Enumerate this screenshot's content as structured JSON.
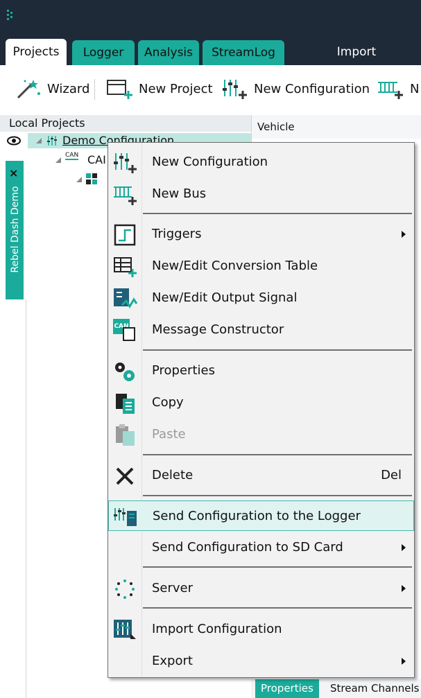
{
  "tabs": [
    {
      "label": "Projects"
    },
    {
      "label": "Logger"
    },
    {
      "label": "Analysis"
    },
    {
      "label": "StreamLog"
    },
    {
      "label": "Import"
    }
  ],
  "ribbon": {
    "wizard": "Wizard",
    "new_project": "New Project",
    "new_configuration": "New Configuration",
    "new_bus_partial": "N"
  },
  "left_panel": {
    "header": "Local Projects",
    "tree": {
      "project": "Demo Configuration",
      "bus": "CAI",
      "bus_icon_text": "CAN"
    },
    "side_tab": "Rebel Dash Demo",
    "side_tab_close": "×"
  },
  "right_panel": {
    "header": "Vehicle",
    "bottom_tabs": [
      {
        "label": "Properties"
      },
      {
        "label": "Stream Channels"
      }
    ]
  },
  "context_menu": {
    "items": [
      {
        "label": "New Configuration",
        "icon": "new-configuration-icon"
      },
      {
        "label": "New Bus",
        "icon": "new-bus-icon"
      },
      {
        "label": "Triggers",
        "icon": "triggers-icon"
      },
      {
        "label": "New/Edit Conversion Table",
        "icon": "conversion-table-icon"
      },
      {
        "label": "New/Edit Output Signal",
        "icon": "output-signal-icon"
      },
      {
        "label": "Message Constructor",
        "icon": "message-constructor-icon",
        "icon_text": "CAN"
      },
      {
        "label": "Properties",
        "icon": "gears-icon"
      },
      {
        "label": "Copy",
        "icon": "copy-icon"
      },
      {
        "label": "Paste",
        "icon": "paste-icon"
      },
      {
        "label": "Delete",
        "icon": "delete-icon",
        "shortcut": "Del"
      },
      {
        "label": "Send Configuration to the Logger",
        "icon": "send-to-logger-icon"
      },
      {
        "label": "Send Configuration to SD Card"
      },
      {
        "label": "Server",
        "icon": "server-icon"
      },
      {
        "label": "Import Configuration",
        "icon": "import-configuration-icon"
      },
      {
        "label": "Export"
      }
    ]
  },
  "colors": {
    "accent": "#1aab9b",
    "titlebar": "#1f2a38",
    "highlight": "#dff3f1"
  }
}
